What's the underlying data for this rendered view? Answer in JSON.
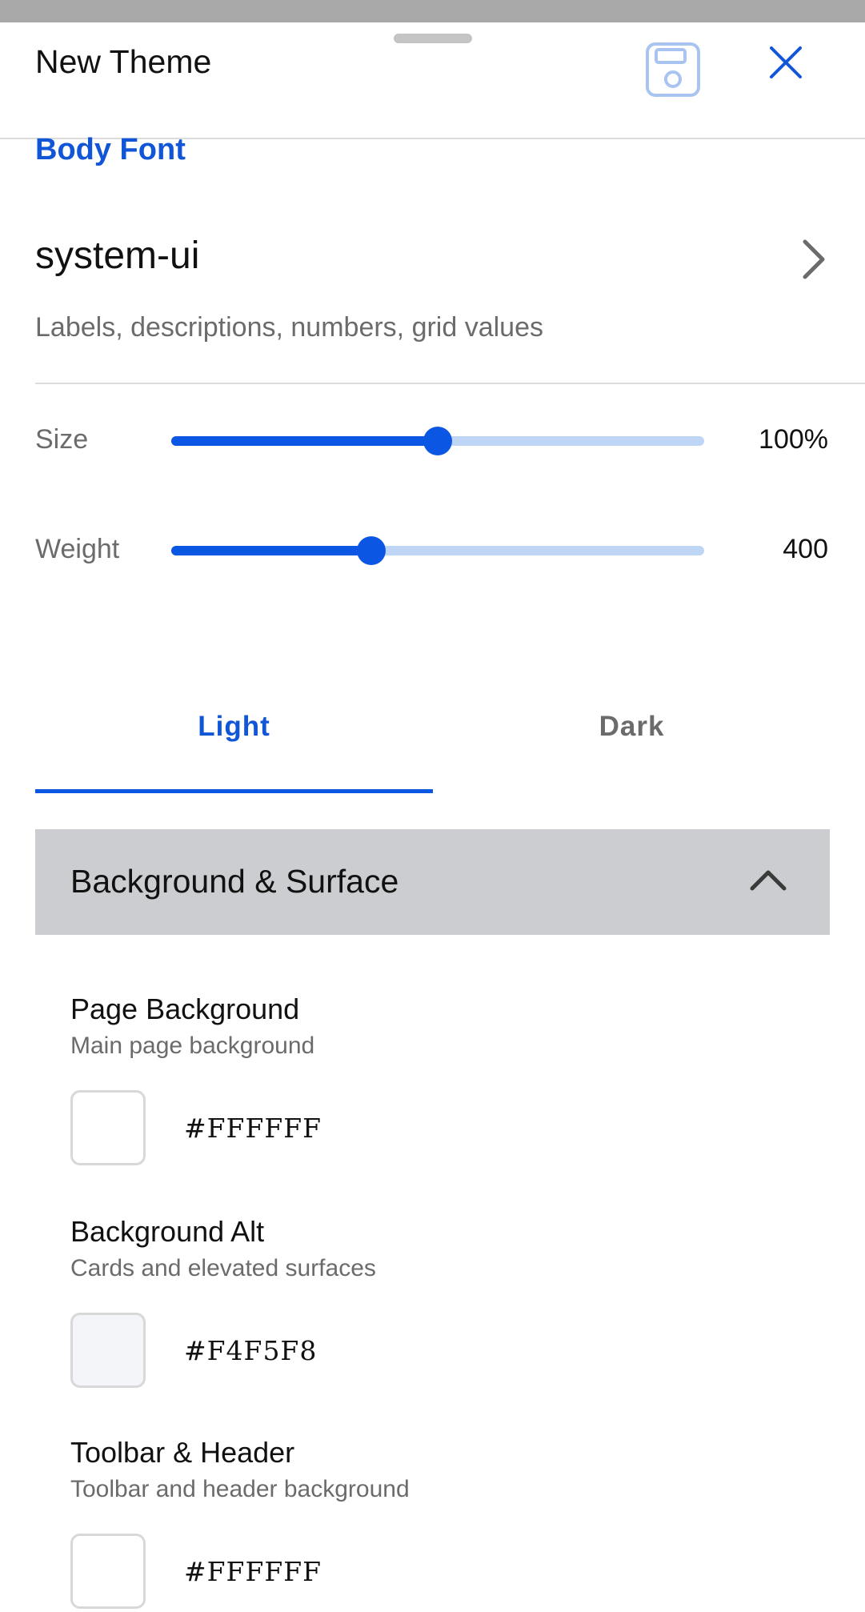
{
  "header": {
    "title": "New Theme",
    "save_icon": "floppy-disk-icon",
    "close_icon": "close-icon"
  },
  "body_font": {
    "section_label": "Body Font",
    "font_name": "system-ui",
    "description": "Labels, descriptions, numbers, grid values",
    "size": {
      "label": "Size",
      "value_text": "100%",
      "fraction": 0.5
    },
    "weight": {
      "label": "Weight",
      "value_text": "400",
      "fraction": 0.375
    }
  },
  "tabs": [
    {
      "label": "Light",
      "active": true
    },
    {
      "label": "Dark",
      "active": false
    }
  ],
  "accordion": {
    "title": "Background & Surface",
    "expanded": true
  },
  "colors": [
    {
      "name": "Page Background",
      "description": "Main page background",
      "hex": "#FFFFFF"
    },
    {
      "name": "Background Alt",
      "description": "Cards and elevated surfaces",
      "hex": "#F4F5F8"
    },
    {
      "name": "Toolbar & Header",
      "description": "Toolbar and header background",
      "hex": "#FFFFFF"
    }
  ],
  "theme_colors": {
    "accent": "#0B57E3",
    "accent_light": "#BFD5F6",
    "section_header_bg": "#CCCDD0"
  }
}
